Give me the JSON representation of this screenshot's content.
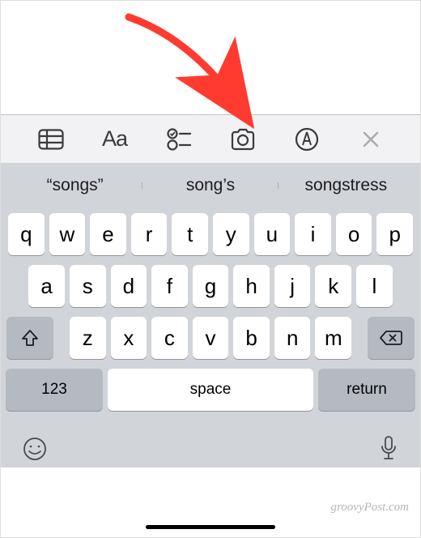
{
  "formattingBar": {
    "aa_label": "Aa"
  },
  "suggestions": [
    "“songs”",
    "song’s",
    "songstress"
  ],
  "keyboard": {
    "row1": [
      "q",
      "w",
      "e",
      "r",
      "t",
      "y",
      "u",
      "i",
      "o",
      "p"
    ],
    "row2": [
      "a",
      "s",
      "d",
      "f",
      "g",
      "h",
      "j",
      "k",
      "l"
    ],
    "row3": [
      "z",
      "x",
      "c",
      "v",
      "b",
      "n",
      "m"
    ],
    "numKey": "123",
    "spaceKey": "space",
    "returnKey": "return"
  },
  "watermark": "groovyPost.com"
}
